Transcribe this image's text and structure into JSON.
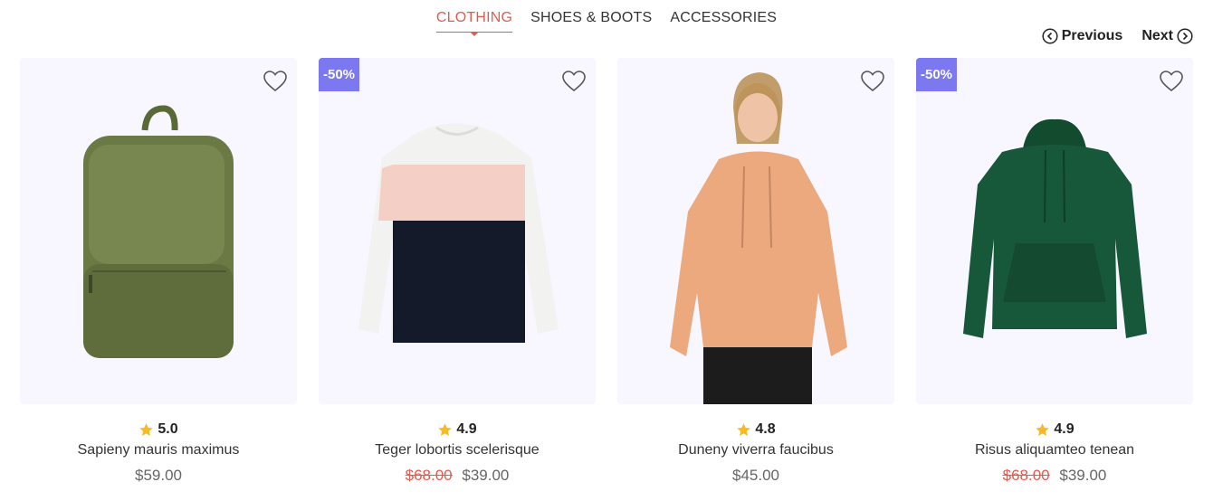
{
  "tabs": [
    {
      "label": "CLOTHING",
      "active": true
    },
    {
      "label": "SHOES & BOOTS",
      "active": false
    },
    {
      "label": "ACCESSORIES",
      "active": false
    }
  ],
  "pager": {
    "previous": "Previous",
    "next": "Next"
  },
  "products": [
    {
      "name": "Sapieny mauris maximus",
      "rating": "5.0",
      "price": "$59.00",
      "old_price": "",
      "badge": "",
      "image": "green-backpack"
    },
    {
      "name": "Teger lobortis scelerisque",
      "rating": "4.9",
      "price": "$39.00",
      "old_price": "$68.00",
      "badge": "-50%",
      "image": "striped-sweater"
    },
    {
      "name": "Duneny viverra faucibus",
      "rating": "4.8",
      "price": "$45.00",
      "old_price": "",
      "badge": "",
      "image": "peach-hoodie-model"
    },
    {
      "name": "Risus aliquamteo tenean",
      "rating": "4.9",
      "price": "$39.00",
      "old_price": "$68.00",
      "badge": "-50%",
      "image": "green-hoodie"
    }
  ],
  "colors": {
    "accent": "#e55a4f",
    "badge": "#7b78f0",
    "star": "#f7b924",
    "card_bg": "#f8f6ff"
  }
}
